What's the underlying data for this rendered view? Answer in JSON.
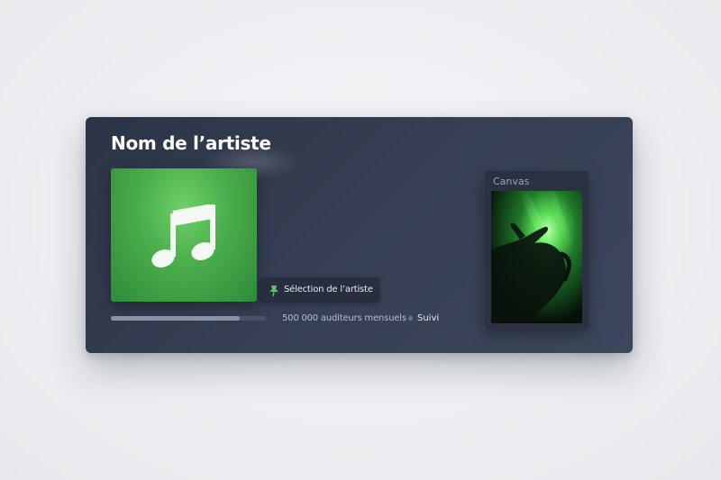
{
  "artist": {
    "name": "Nom de l’artiste"
  },
  "cover": {
    "icon": "music-note-icon",
    "color": "#4bb04c"
  },
  "artist_pick": {
    "icon": "pin-icon",
    "label": "Sélection de l’artiste"
  },
  "progress": {
    "fraction": 0.83
  },
  "stats": {
    "listeners": "500 000 auditeurs mensuels",
    "follow_label": "Suivi"
  },
  "canvas": {
    "title": "Canvas"
  },
  "colors": {
    "card_bg": "#353e52",
    "accent_green": "#4bb04c",
    "text_primary": "#ffffff",
    "text_secondary": "#b7bdc8"
  }
}
